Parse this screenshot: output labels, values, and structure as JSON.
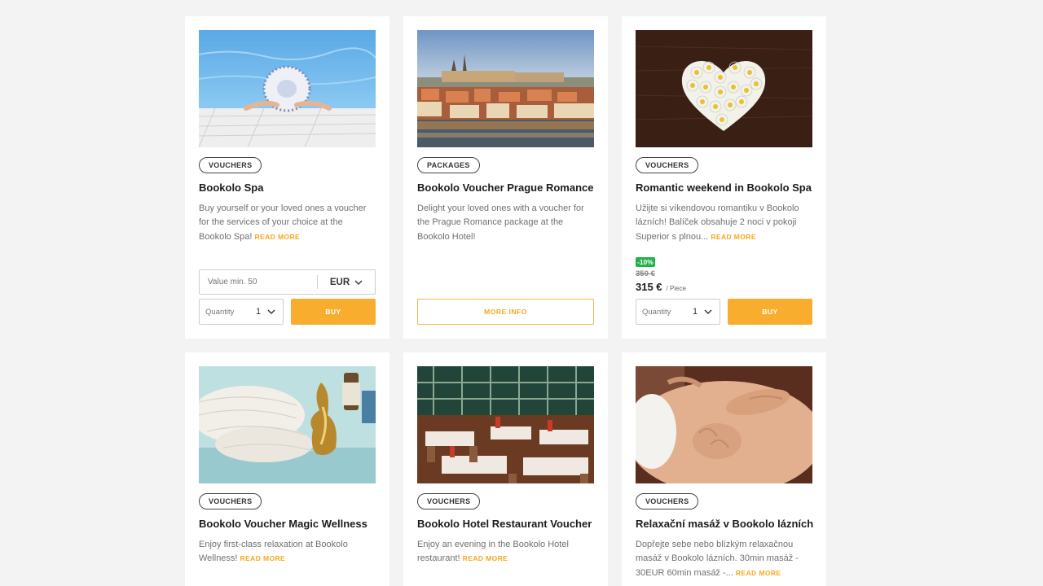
{
  "cards": [
    {
      "tag": "VOUCHERS",
      "title": "Bookolo Spa",
      "description": "Buy yourself or your loved ones a voucher for the services of your choice at the Bookolo Spa!",
      "read_more": "READ MORE",
      "value_placeholder": "Value min. 50",
      "currency": "EUR",
      "quantity_label": "Quantity",
      "quantity": "1",
      "buy_label": "BUY"
    },
    {
      "tag": "PACKAGES",
      "title": "Bookolo Voucher Prague Romance",
      "description": "Delight your loved ones with a voucher for the Prague Romance package at the Bookolo Hotel!",
      "more_info_label": "MORE INFO"
    },
    {
      "tag": "VOUCHERS",
      "title": "Romantic weekend in Bookolo Spa",
      "description": "Užijte si víkendovou romantiku v Bookolo lázních! Balíček obsahuje 2 noci v pokoji Superior s plnou...",
      "read_more": "READ MORE",
      "discount": "-10%",
      "old_price": "350 €",
      "price": "315 €",
      "unit": "/ Piece",
      "quantity_label": "Quantity",
      "quantity": "1",
      "buy_label": "BUY"
    },
    {
      "tag": "VOUCHERS",
      "title": "Bookolo Voucher Magic Wellness",
      "description": "Enjoy first-class relaxation at Bookolo Wellness!",
      "read_more": "READ MORE"
    },
    {
      "tag": "VOUCHERS",
      "title": "Bookolo Hotel Restaurant Voucher",
      "description": "Enjoy an evening in the Bookolo Hotel restaurant!",
      "read_more": "READ MORE"
    },
    {
      "tag": "VOUCHERS",
      "title": "Relaxační masáž v Bookolo lázních",
      "description": "Dopřejte sebe nebo blízkým relaxačnou masáž v Bookolo lázních.  30min masáž - 30EUR  60min masáž -...",
      "read_more": "READ MORE"
    }
  ],
  "colors": {
    "accent": "#f9ad2f",
    "discount": "#22b24c",
    "background": "#f3f3f3"
  },
  "icons": [
    "chevron-down-icon"
  ]
}
